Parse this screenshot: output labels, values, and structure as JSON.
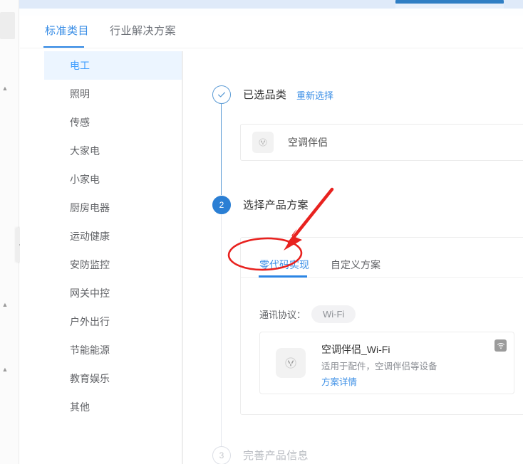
{
  "top_tabs": {
    "items": [
      {
        "label": "标准类目",
        "active": true
      },
      {
        "label": "行业解决方案",
        "active": false
      }
    ]
  },
  "categories": {
    "items": [
      {
        "label": "电工",
        "active": true
      },
      {
        "label": "照明",
        "active": false
      },
      {
        "label": "传感",
        "active": false
      },
      {
        "label": "大家电",
        "active": false
      },
      {
        "label": "小家电",
        "active": false
      },
      {
        "label": "厨房电器",
        "active": false
      },
      {
        "label": "运动健康",
        "active": false
      },
      {
        "label": "安防监控",
        "active": false
      },
      {
        "label": "网关中控",
        "active": false
      },
      {
        "label": "户外出行",
        "active": false
      },
      {
        "label": "节能能源",
        "active": false
      },
      {
        "label": "教育娱乐",
        "active": false
      },
      {
        "label": "其他",
        "active": false
      }
    ]
  },
  "steps": {
    "step1": {
      "marker": "check-icon",
      "title": "已选品类",
      "reselect_link": "重新选择",
      "selected_item": {
        "name": "空调伴侣",
        "icon": "power-socket-icon"
      }
    },
    "step2": {
      "marker": "2",
      "title": "选择产品方案",
      "tabs": [
        {
          "label": "零代码实现",
          "active": true
        },
        {
          "label": "自定义方案",
          "active": false
        }
      ],
      "protocol_label": "通讯协议：",
      "protocol_value": "Wi-Fi",
      "product": {
        "title": "空调伴侣_Wi-Fi",
        "desc": "适用于配件，空调伴侣等设备",
        "link": "方案详情",
        "icon": "power-socket-icon",
        "badge_icon": "wifi-icon"
      }
    },
    "step3": {
      "marker": "3",
      "title": "完善产品信息"
    }
  },
  "left_rail": {
    "collapse_handle_icon": "chevron-left-icon",
    "caret_icon": "caret-up-icon"
  },
  "colors": {
    "accent": "#2b85e4",
    "link": "#3a8ee6",
    "active_bg": "#ecf5ff",
    "annotation": "#e8221f",
    "banner": "#dfeaf9"
  },
  "annotations": {
    "arrow": "red-arrow",
    "ellipse": "red-ellipse"
  }
}
